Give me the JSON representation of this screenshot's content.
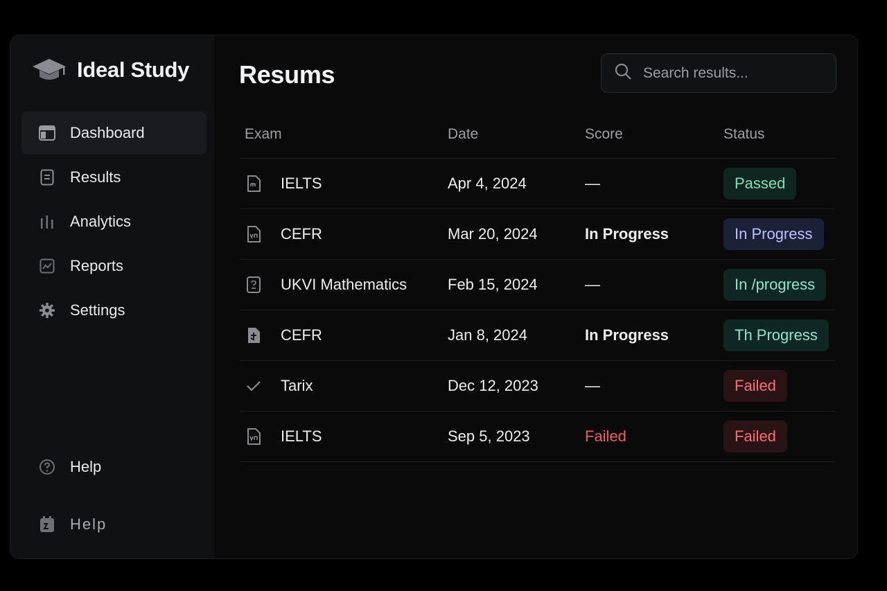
{
  "app": {
    "name": "Ideal Study",
    "logo_icon": "graduation-cap-icon"
  },
  "sidebar": {
    "items": [
      {
        "label": "Dashboard",
        "icon": "layout-icon",
        "active": true
      },
      {
        "label": "Results",
        "icon": "document-icon",
        "active": false
      },
      {
        "label": "Analytics",
        "icon": "bar-chart-icon",
        "active": false
      },
      {
        "label": "Reports",
        "icon": "line-chart-icon",
        "active": false
      },
      {
        "label": "Settings",
        "icon": "gear-icon",
        "active": false
      }
    ],
    "bottom": [
      {
        "label": "Help",
        "icon": "help-circle-icon"
      },
      {
        "label": "Help",
        "icon": "calendar-icon"
      }
    ]
  },
  "main": {
    "title": "Resums",
    "search": {
      "placeholder": "Search results..."
    }
  },
  "table": {
    "columns": [
      "Exam",
      "Date",
      "Score",
      "Status"
    ],
    "rows": [
      {
        "exam": "IELTS",
        "date": "Apr 4, 2024",
        "score": "—",
        "status": "Passed",
        "status_color": "green",
        "icon": "file-icon"
      },
      {
        "exam": "CEFR",
        "date": "Mar 20, 2024",
        "score": "In Progress",
        "status": "In Progress",
        "status_color": "blue",
        "icon": "file-icon"
      },
      {
        "exam": "UKVI Mathematics",
        "date": "Feb 15, 2024",
        "score": "—",
        "status": "In /progress",
        "status_color": "teal",
        "icon": "file-question-icon"
      },
      {
        "exam": "CEFR",
        "date": "Jan 8, 2024",
        "score": "In Progress",
        "status": "Th Progress",
        "status_color": "teal",
        "icon": "file-filled-icon"
      },
      {
        "exam": "Tarix",
        "date": "Dec 12, 2023",
        "score": "—",
        "status": "Failed",
        "status_color": "red",
        "icon": "check-icon"
      },
      {
        "exam": "IELTS",
        "date": "Sep 5, 2023",
        "score": "Failed",
        "status": "Failed",
        "status_color": "red",
        "icon": "file-icon"
      }
    ]
  },
  "colors": {
    "background": "#0a0a0b",
    "sidebar": "#101113",
    "passed": "#7be3b8",
    "in_progress": "#b9c2ff",
    "failed": "#ff6a78"
  }
}
